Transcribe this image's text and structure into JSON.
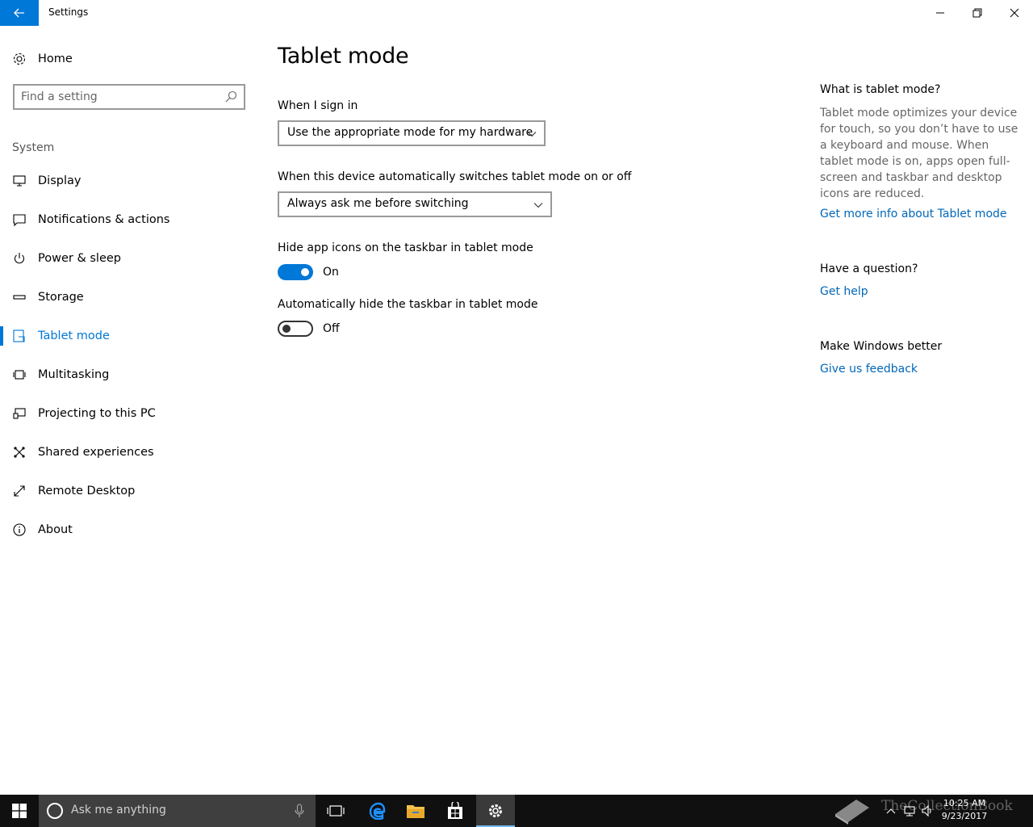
{
  "window": {
    "title": "Settings",
    "back_icon": "arrow-left-icon",
    "controls": [
      "minimize-icon",
      "maximize-icon",
      "close-icon"
    ]
  },
  "sidebar": {
    "home_label": "Home",
    "search_placeholder": "Find a setting",
    "section_label": "System",
    "items": [
      {
        "label": "Display",
        "icon": "monitor-icon",
        "active": false
      },
      {
        "label": "Notifications & actions",
        "icon": "message-icon",
        "active": false
      },
      {
        "label": "Power & sleep",
        "icon": "power-icon",
        "active": false
      },
      {
        "label": "Storage",
        "icon": "storage-icon",
        "active": false
      },
      {
        "label": "Tablet mode",
        "icon": "tablet-mode-icon",
        "active": true
      },
      {
        "label": "Multitasking",
        "icon": "multitasking-icon",
        "active": false
      },
      {
        "label": "Projecting to this PC",
        "icon": "projecting-icon",
        "active": false
      },
      {
        "label": "Shared experiences",
        "icon": "shared-icon",
        "active": false
      },
      {
        "label": "Remote Desktop",
        "icon": "remote-desktop-icon",
        "active": false
      },
      {
        "label": "About",
        "icon": "info-icon",
        "active": false
      }
    ]
  },
  "main": {
    "title": "Tablet mode",
    "signin": {
      "label": "When I sign in",
      "value": "Use the appropriate mode for my hardware"
    },
    "switch": {
      "label": "When this device automatically switches tablet mode on or off",
      "value": "Always ask me before switching"
    },
    "hide_icons": {
      "label": "Hide app icons on the taskbar in tablet mode",
      "state": "On",
      "on": true
    },
    "hide_taskbar": {
      "label": "Automatically hide the taskbar in tablet mode",
      "state": "Off",
      "on": false
    }
  },
  "aside": {
    "what_heading": "What is tablet mode?",
    "what_text": "Tablet mode optimizes your device for touch, so you don’t have to use a keyboard and mouse. When tablet mode is on, apps open full-screen and taskbar and desktop icons are reduced.",
    "what_link": "Get more info about Tablet mode",
    "question_heading": "Have a question?",
    "question_link": "Get help",
    "better_heading": "Make Windows better",
    "better_link": "Give us feedback"
  },
  "taskbar": {
    "cortana_text": "Ask me anything",
    "apps": [
      "task-view-icon",
      "edge-icon",
      "file-explorer-icon",
      "store-icon",
      "settings-gear-icon"
    ],
    "time": "10:25 AM",
    "date": "9/23/2017",
    "watermark": "TheCollectionBook"
  },
  "colors": {
    "accent": "#0078d7",
    "link": "#0067b8",
    "taskbar": "#101010"
  }
}
